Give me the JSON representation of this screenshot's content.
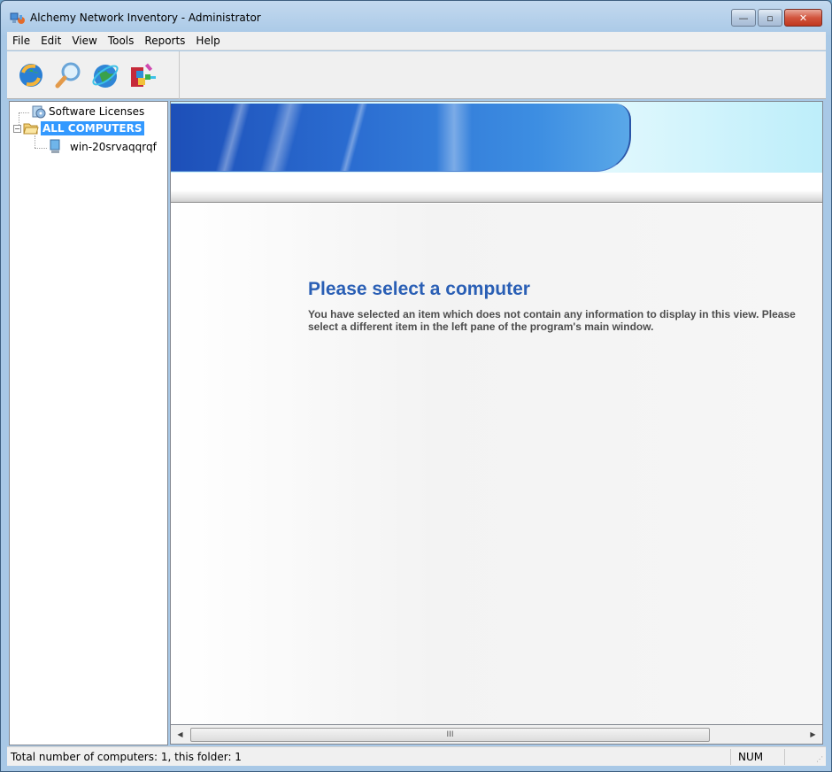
{
  "window": {
    "title": "Alchemy Network Inventory - Administrator",
    "controls": {
      "minimize": "—",
      "maximize": "▫",
      "close": "✕"
    }
  },
  "menu": [
    "File",
    "Edit",
    "View",
    "Tools",
    "Reports",
    "Help"
  ],
  "toolbar": {
    "buttons": [
      {
        "name": "refresh-icon"
      },
      {
        "name": "search-icon"
      },
      {
        "name": "internet-globe-icon"
      },
      {
        "name": "uninstall-icon"
      }
    ]
  },
  "tree": {
    "items": [
      {
        "label": "Software Licenses",
        "icon": "software-licenses-icon"
      },
      {
        "label": "ALL COMPUTERS",
        "icon": "folder-open-icon",
        "selected": true,
        "expander": "−"
      },
      {
        "label": "win-20srvaqqrqf",
        "icon": "computer-icon"
      }
    ]
  },
  "main": {
    "title": "Please select a computer",
    "body": "You have selected an item which does not contain any information to display in this view. Please select a different item in the left pane of the program's main window."
  },
  "scrollbar": {
    "left_arrow": "◀",
    "right_arrow": "▶",
    "grip": "III"
  },
  "status": {
    "text": "Total number of computers: 1, this folder: 1",
    "num": "NUM"
  }
}
